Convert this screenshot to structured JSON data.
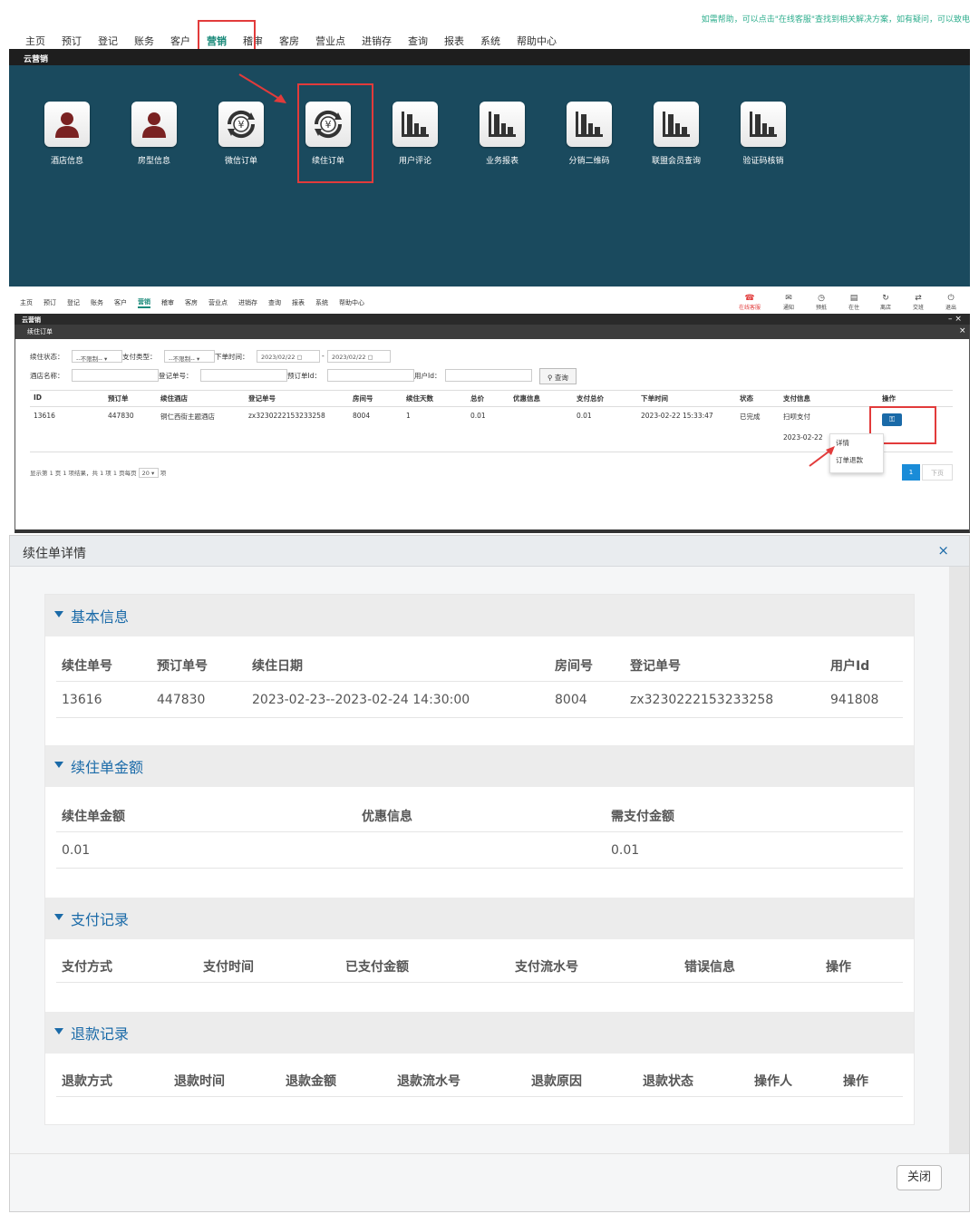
{
  "top": {
    "help_text": "如需帮助，可以点击\"在线客服\"查找到相关解决方案，如有疑问，可以致电",
    "nav": [
      "主页",
      "预订",
      "登记",
      "账务",
      "客户",
      "营销",
      "稽审",
      "客房",
      "营业点",
      "进销存",
      "查询",
      "报表",
      "系统",
      "帮助中心"
    ],
    "active_nav": "营销",
    "section_bar": "云营销",
    "tiles": [
      {
        "label": "酒店信息",
        "icon": "person-icon"
      },
      {
        "label": "房型信息",
        "icon": "person-icon"
      },
      {
        "label": "微信订单",
        "icon": "yuan-cycle-icon"
      },
      {
        "label": "续住订单",
        "icon": "yuan-cycle-icon"
      },
      {
        "label": "用户评论",
        "icon": "bar-chart-icon"
      },
      {
        "label": "业务报表",
        "icon": "bar-chart-icon"
      },
      {
        "label": "分销二维码",
        "icon": "bar-chart-icon"
      },
      {
        "label": "联盟会员查询",
        "icon": "bar-chart-icon"
      },
      {
        "label": "验证码核销",
        "icon": "bar-chart-icon"
      }
    ]
  },
  "list": {
    "nav": [
      "主页",
      "预订",
      "登记",
      "账务",
      "客户",
      "营销",
      "稽审",
      "客房",
      "营业点",
      "进销存",
      "查询",
      "报表",
      "系统",
      "帮助中心"
    ],
    "right_tools": [
      {
        "label": "在线客服",
        "glyph": "☎"
      },
      {
        "label": "通知",
        "glyph": "✉"
      },
      {
        "label": "预抵",
        "glyph": "◷"
      },
      {
        "label": "在住",
        "glyph": "▤"
      },
      {
        "label": "离店",
        "glyph": "↻"
      },
      {
        "label": "交班",
        "glyph": "⇄"
      },
      {
        "label": "退出",
        "glyph": "⏻"
      }
    ],
    "bar_title": "云营销",
    "sub_title": "续住订单",
    "filters": {
      "status_label": "续住状态：",
      "status_value": "--不限制--",
      "pay_type_label": "支付类型：",
      "pay_type_value": "--不限制--",
      "order_time_label": "下单时间：",
      "date_from": "2023/02/22",
      "date_to": "2023/02/22",
      "hotel_label": "酒店名称：",
      "reg_label": "登记单号：",
      "book_label": "预订单Id：",
      "user_label": "用户Id：",
      "query_button": "查询"
    },
    "columns": [
      "ID",
      "预订单",
      "续住酒店",
      "登记单号",
      "房间号",
      "续住天数",
      "总价",
      "优惠信息",
      "支付总价",
      "下单时间",
      "状态",
      "支付信息",
      "操作"
    ],
    "rows": [
      {
        "id": "13616",
        "booking": "447830",
        "hotel": "铜仁西街主题酒店",
        "reg_no": "zx3230222153233258",
        "room": "8004",
        "days": "1",
        "total": "0.01",
        "discount": "",
        "paid": "0.01",
        "time": "2023-02-22 15:33:47",
        "status": "已完成",
        "pay_info": "扫呗支付",
        "pay_date": "2023-02-22"
      }
    ],
    "menu": [
      "详情",
      "订单退款"
    ],
    "pager_text": "显示第 1 页 1 项结果，共 1 项 1 页每页",
    "page_size": "20",
    "page_unit": "项",
    "page_current": "1",
    "page_next": "下页"
  },
  "detail": {
    "title": "续住单详情",
    "close_x": "×",
    "close_button": "关闭",
    "basic": {
      "title": "基本信息",
      "headers": [
        "续住单号",
        "预订单号",
        "续住日期",
        "房间号",
        "登记单号",
        "用户Id"
      ],
      "values": [
        "13616",
        "447830",
        "2023-02-23--2023-02-24 14:30:00",
        "8004",
        "zx3230222153233258",
        "941808"
      ]
    },
    "amount": {
      "title": "续住单金额",
      "headers": [
        "续住单金额",
        "优惠信息",
        "需支付金额"
      ],
      "values": [
        "0.01",
        "",
        "0.01"
      ]
    },
    "payment": {
      "title": "支付记录",
      "headers": [
        "支付方式",
        "支付时间",
        "已支付金额",
        "支付流水号",
        "错误信息",
        "操作"
      ]
    },
    "refund": {
      "title": "退款记录",
      "headers": [
        "退款方式",
        "退款时间",
        "退款金额",
        "退款流水号",
        "退款原因",
        "退款状态",
        "操作人",
        "操作"
      ]
    }
  },
  "colors": {
    "accent": "#1a6aa8",
    "teal": "#1a8a7a",
    "canvas": "#1a4a5e",
    "highlight": "#e23b3b"
  }
}
